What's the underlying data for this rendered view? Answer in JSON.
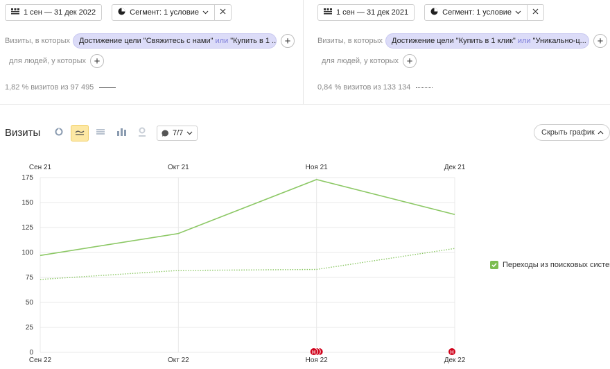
{
  "left_panel": {
    "date_range": "1 сен — 31 дек 2022",
    "segment_label": "Сегмент: 1 условие",
    "visits_prefix": "Визиты, в которых",
    "condition_chip": {
      "part1": "Достижение цели \"Свяжитесь с нами\"",
      "or": "или",
      "part2": "\"Купить в 1 ..."
    },
    "people_prefix": "для людей, у которых",
    "stat": "1,82 % визитов из 97 495"
  },
  "right_panel": {
    "date_range": "1 сен — 31 дек 2021",
    "segment_label": "Сегмент: 1 условие",
    "visits_prefix": "Визиты, в которых",
    "condition_chip": {
      "part1": "Достижение цели \"Купить в 1 клик\"",
      "or": "или",
      "part2": "\"Уникально-ц..."
    },
    "people_prefix": "для людей, у которых",
    "stat": "0,84 % визитов из 133 134"
  },
  "report": {
    "title": "Визиты",
    "comments_count": "7/7",
    "hide_chart_label": "Скрыть график"
  },
  "colors": {
    "series": "#8cc865",
    "chip_bg": "#dcdcf8",
    "active_view": "#fde8a4",
    "annotation": "#d0021b"
  },
  "icons": {
    "calendar": "calendar-icon",
    "segment": "pie-segment-icon",
    "close": "close-icon",
    "add": "plus-icon",
    "chevron": "chevron-down-icon",
    "comment": "comment-icon"
  },
  "chart_data": {
    "type": "line",
    "top_categories": [
      "Сен 21",
      "Окт 21",
      "Ноя 21",
      "Дек 21"
    ],
    "categories": [
      "Сен 22",
      "Окт 22",
      "Ноя 22",
      "Дек 22"
    ],
    "yticks": [
      0,
      25,
      50,
      75,
      100,
      125,
      150,
      175
    ],
    "ylim": [
      0,
      175
    ],
    "grid": true,
    "legend": {
      "placement": "right",
      "label": "Переходы из поисковых систем"
    },
    "series": [
      {
        "style": "solid",
        "values": [
          97,
          119,
          173,
          138
        ]
      },
      {
        "style": "dotted",
        "values": [
          73,
          82,
          83,
          104
        ]
      }
    ],
    "annotation_markers": [
      {
        "category_index": 2,
        "count": 3,
        "label": "Н"
      },
      {
        "category_index": 3,
        "count": 1,
        "label": "Н"
      }
    ]
  }
}
